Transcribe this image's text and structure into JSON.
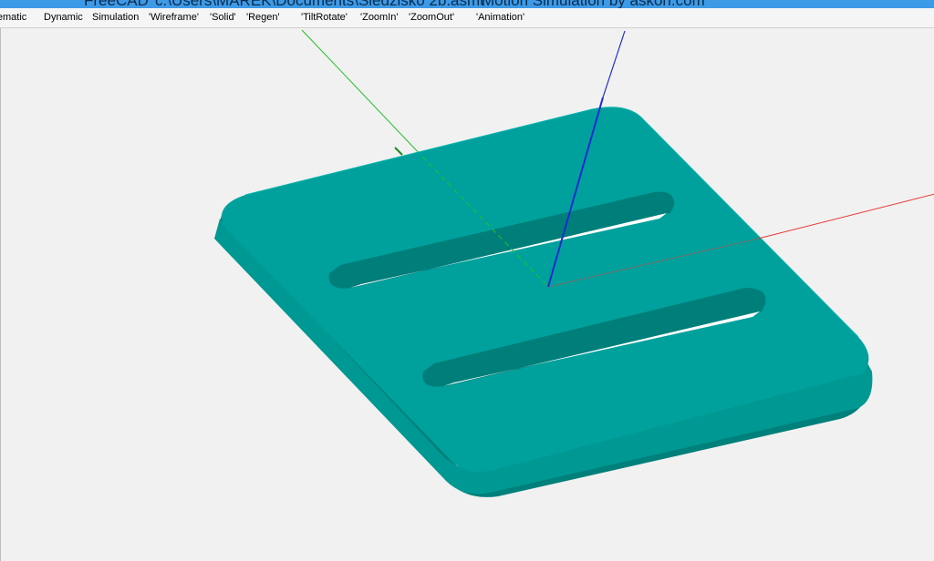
{
  "window": {
    "title_app": "FreeCAD",
    "title_path": "c:\\Users\\MAREK\\Documents\\Siedzisko 2b.asmt",
    "title_tagline": "Motion Simulation by askoh.com"
  },
  "menu": {
    "items": [
      {
        "label": "Kinematic"
      },
      {
        "label": "Dynamic"
      },
      {
        "label": "Simulation"
      },
      {
        "label": "'Wireframe'"
      },
      {
        "label": "'Solid'"
      },
      {
        "label": "'Regen'"
      },
      {
        "label": "'TiltRotate'"
      },
      {
        "label": "'ZoomIn'"
      },
      {
        "label": "'ZoomOut'"
      },
      {
        "label": "'Animation'"
      }
    ]
  },
  "scene": {
    "background_color": "#f1f1f1",
    "plate_top_color": "#00a19c",
    "plate_side_color": "#009892",
    "plate_shadow_color": "#00807b",
    "axis_x_color": "#e53935",
    "axis_y_color": "#22c02a",
    "axis_z_color": "#1f2ad0",
    "icons": [
      "x-axis-icon",
      "y-axis-icon",
      "z-axis-icon"
    ]
  }
}
